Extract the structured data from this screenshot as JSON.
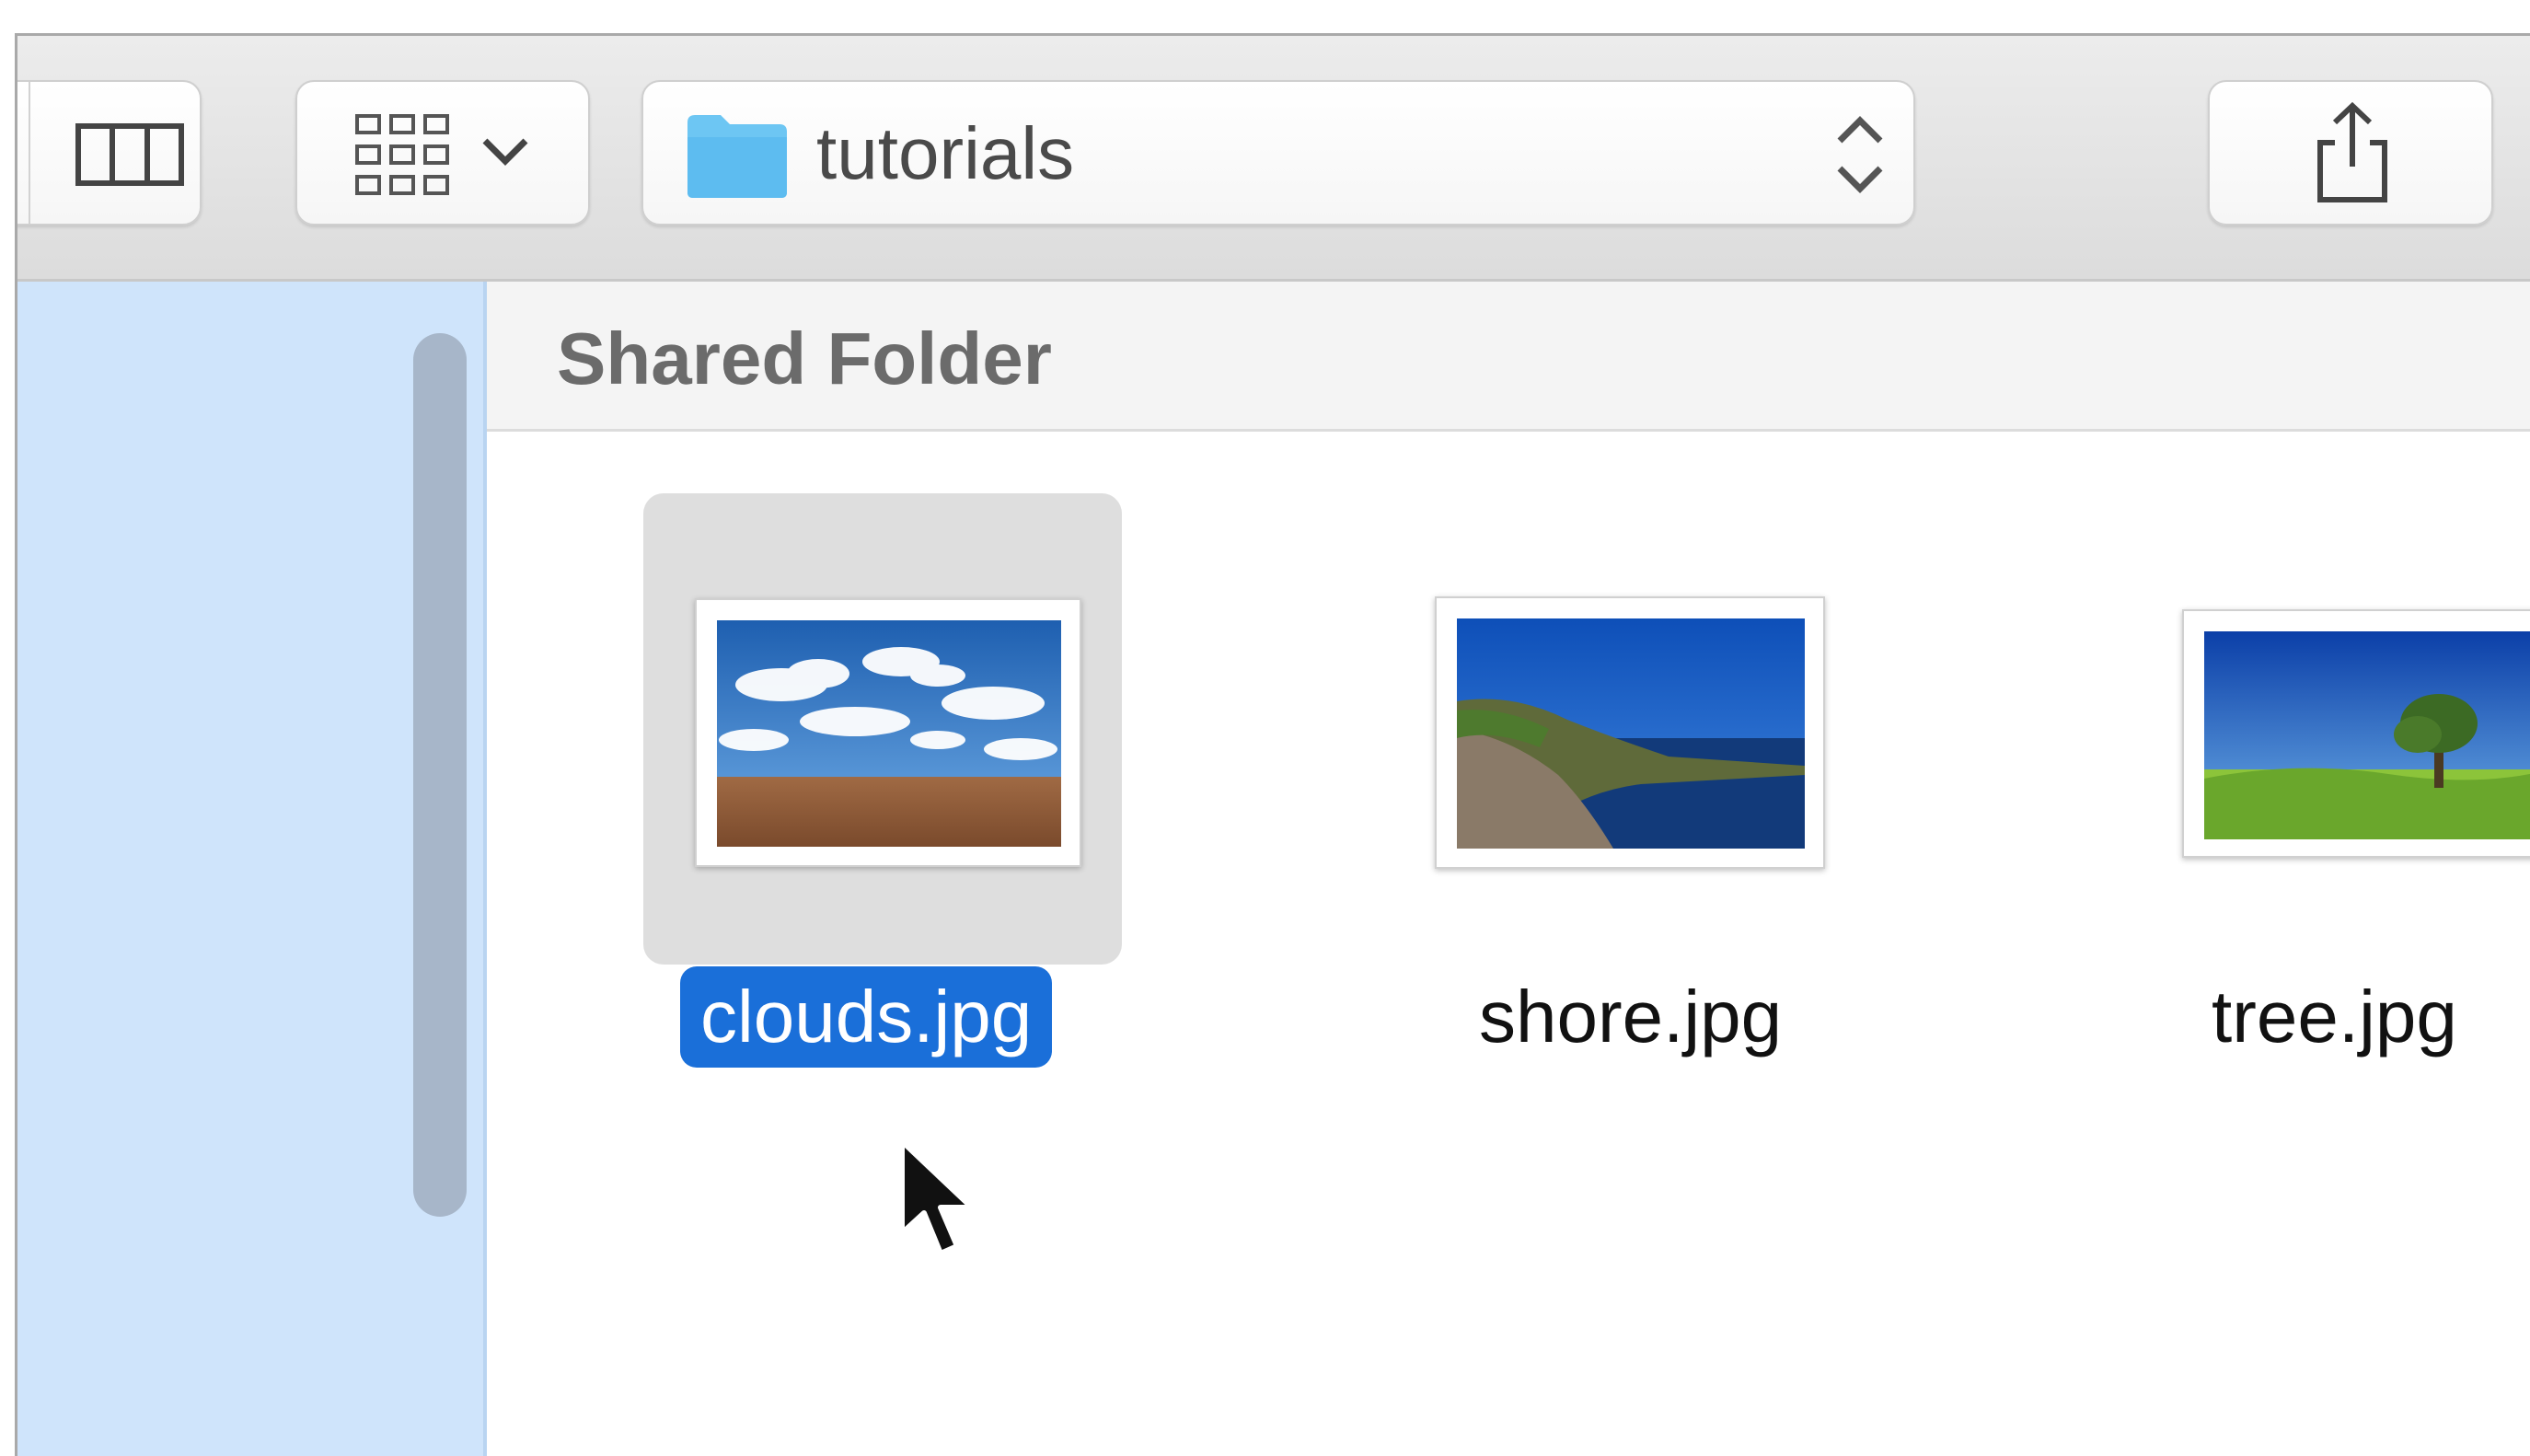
{
  "toolbar": {
    "path_folder": "tutorials"
  },
  "content": {
    "title": "Shared Folder",
    "files": [
      {
        "name": "clouds.jpg",
        "selected": true
      },
      {
        "name": "shore.jpg",
        "selected": false
      },
      {
        "name": "tree.jpg",
        "selected": false
      }
    ]
  },
  "icons": {
    "columns_view": "columns-view-icon",
    "icon_view": "grid-view-icon",
    "folder": "folder-icon",
    "path_stepper": "chevron-updown-icon",
    "share": "share-icon"
  },
  "colors": {
    "selection": "#1a6fd9",
    "sidebar": "#cfe4fb",
    "folder": "#5fc3f5"
  }
}
